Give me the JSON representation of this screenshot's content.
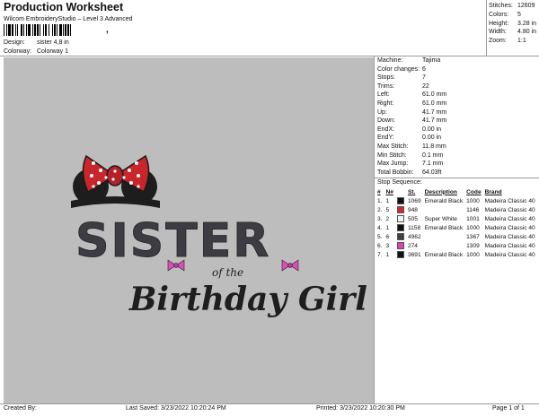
{
  "header": {
    "title": "Production Worksheet",
    "software": "Wilcom EmbroideryStudio – Level 3 Advanced",
    "design_label": "Design:",
    "design_value": "sister 4,8 in",
    "colorway_label": "Colorway:",
    "colorway_value": "Colorway 1"
  },
  "stats": [
    {
      "label": "Stitches:",
      "value": "12609"
    },
    {
      "label": "Colors:",
      "value": "5"
    },
    {
      "label": "Height:",
      "value": "3.28 in"
    },
    {
      "label": "Width:",
      "value": "4.80 in"
    },
    {
      "label": "Zoom:",
      "value": "1:1"
    }
  ],
  "design_text": {
    "main_word": "SISTER",
    "small_words": "of the",
    "script_line": "Birthday Girl"
  },
  "machine_info": [
    {
      "label": "Machine:",
      "value": "Tajima"
    },
    {
      "label": "Color changes:",
      "value": "6"
    },
    {
      "label": "Stops:",
      "value": "7"
    },
    {
      "label": "Trims:",
      "value": "22"
    },
    {
      "label": "Left:",
      "value": "61.0 mm"
    },
    {
      "label": "Right:",
      "value": "61.0 mm"
    },
    {
      "label": "Up:",
      "value": "41.7 mm"
    },
    {
      "label": "Down:",
      "value": "41.7 mm"
    },
    {
      "label": "EndX:",
      "value": "0.00 in"
    },
    {
      "label": "EndY:",
      "value": "0.00 in"
    },
    {
      "label": "Max Stitch:",
      "value": "11.8 mm"
    },
    {
      "label": "Min Stitch:",
      "value": "0.1 mm"
    },
    {
      "label": "Max Jump:",
      "value": "7.1 mm"
    },
    {
      "label": "Total Bobbin:",
      "value": "64.03ft"
    }
  ],
  "stop_sequence": {
    "title": "Stop Sequence:",
    "columns": [
      "#",
      "N#",
      "",
      "St.",
      "Description",
      "Code",
      "Brand"
    ],
    "rows": [
      {
        "num": "1.",
        "n": "1",
        "color": "#111111",
        "st": "1069",
        "desc": "Emerald Black",
        "code": "1000",
        "brand": "Madeira Classic 40"
      },
      {
        "num": "2.",
        "n": "5",
        "color": "#d42a2a",
        "st": "948",
        "desc": "",
        "code": "1146",
        "brand": "Madeira Classic 40"
      },
      {
        "num": "3.",
        "n": "2",
        "color": "#f2f2f2",
        "st": "505",
        "desc": "Super White",
        "code": "1001",
        "brand": "Madeira Classic 40"
      },
      {
        "num": "4.",
        "n": "1",
        "color": "#111111",
        "st": "1158",
        "desc": "Emerald Black",
        "code": "1000",
        "brand": "Madeira Classic 40"
      },
      {
        "num": "5.",
        "n": "6",
        "color": "#3f3f4a",
        "st": "4962",
        "desc": "",
        "code": "1367",
        "brand": "Madeira Classic 40"
      },
      {
        "num": "6.",
        "n": "3",
        "color": "#e040b0",
        "st": "274",
        "desc": "",
        "code": "1309",
        "brand": "Madeira Classic 40"
      },
      {
        "num": "7.",
        "n": "1",
        "color": "#111111",
        "st": "3691",
        "desc": "Emerald Black",
        "code": "1000",
        "brand": "Madeira Classic 40"
      }
    ]
  },
  "footer": {
    "created": "Created By:",
    "saved": "Last Saved: 3/23/2022 10:20:24 PM",
    "printed": "Printed: 3/23/2022 10:20:30 PM",
    "page": "Page 1 of 1"
  }
}
